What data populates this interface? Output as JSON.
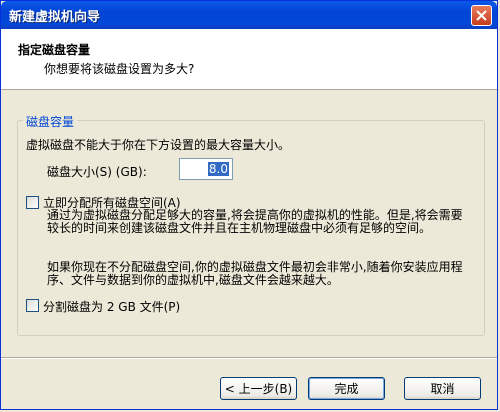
{
  "window": {
    "title": "新建虚拟机向导"
  },
  "header": {
    "title": "指定磁盘容量",
    "subtitle": "你想要将该磁盘设置为多大?"
  },
  "group": {
    "legend": "磁盘容量",
    "max_note": "虚拟磁盘不能大于你在下方设置的最大容量大小。",
    "size_label": "磁盘大小(S) (GB):",
    "size_value": "8.0"
  },
  "allocate": {
    "label": "立即分配所有磁盘空间(A)",
    "checked": false,
    "desc1": "通过为虚拟磁盘分配足够大的容量,将会提高你的虚拟机的性能。但是,将会需要较长的时间来创建该磁盘文件并且在主机物理磁盘中必须有足够的空间。",
    "desc2": "如果你现在不分配磁盘空间,你的虚拟磁盘文件最初会非常小,随着你安装应用程序、文件与数据到你的虚拟机中,磁盘文件会越来越大。"
  },
  "split": {
    "label": "分割磁盘为 2 GB 文件(P)",
    "checked": false
  },
  "buttons": {
    "back": "< 上一步(B)",
    "finish": "完成",
    "cancel": "取消"
  }
}
